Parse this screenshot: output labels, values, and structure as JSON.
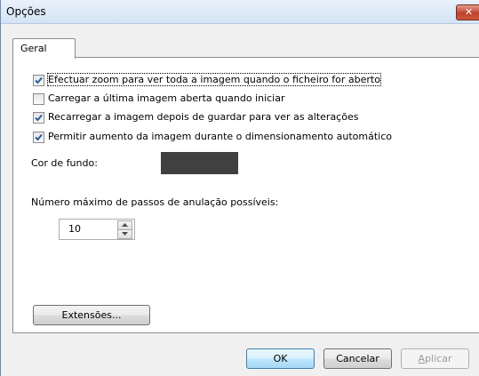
{
  "window": {
    "title": "Opções",
    "close_glyph": "✕"
  },
  "tabs": [
    {
      "label": "Geral",
      "selected": true
    }
  ],
  "options": [
    {
      "label": "Efectuar zoom para ver toda a imagem quando o ficheiro for aberto",
      "checked": true
    },
    {
      "label": "Carregar a última imagem aberta quando iniciar",
      "checked": false
    },
    {
      "label": "Recarregar a imagem depois de guardar para ver as alterações",
      "checked": true
    },
    {
      "label": "Permitir aumento da imagem durante o dimensionamento automático",
      "checked": true
    }
  ],
  "background_color": {
    "label": "Cor de fundo:",
    "value": "#404040"
  },
  "undo": {
    "label": "Número máximo de passos de anulação possíveis:",
    "value": "10"
  },
  "buttons": {
    "extensions": "Extensões...",
    "ok": "OK",
    "cancel": "Cancelar",
    "apply_prefix": "A",
    "apply_rest": "plicar"
  },
  "colors": {
    "checkmark": "#2a5d9f",
    "swatch": "#404040"
  }
}
